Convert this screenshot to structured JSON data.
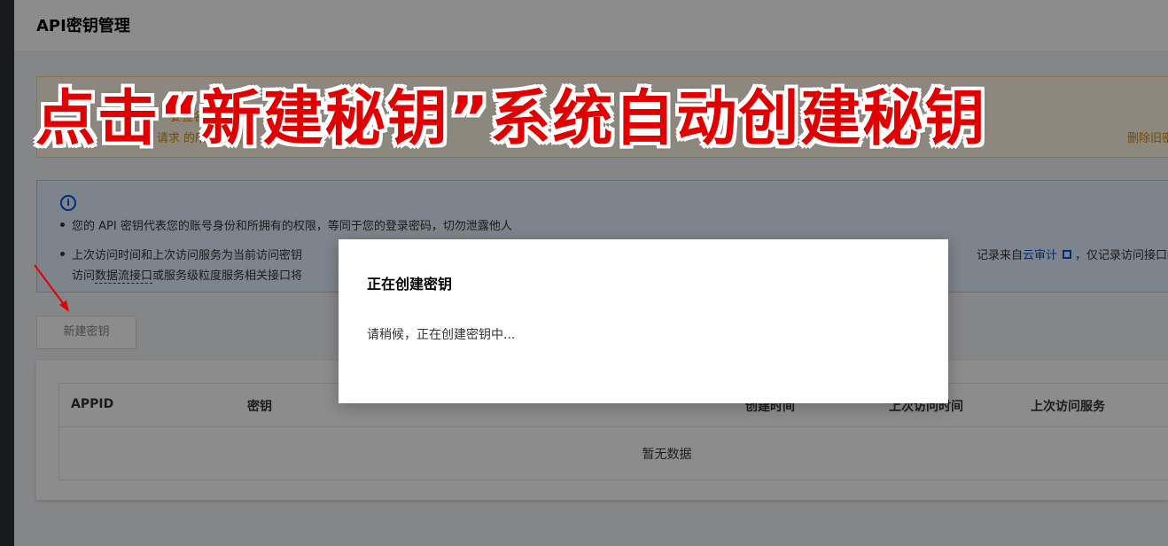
{
  "header": {
    "title": "API密钥管理"
  },
  "warning": {
    "line1": "要签名，云",
    "line2": "讯云 API 请求                                              的所有腾讯",
    "line2_tail": "删除旧密钥"
  },
  "info": {
    "bullet1": "您的 API 密钥代表您的账号身份和所拥有的权限，等同于您的登录密码，切勿泄露他人",
    "bullet2_start": "上次访问时间和上次访问服务为当前访问密钥",
    "bullet2_line2_a": "访问",
    "bullet2_line2_dashed": "数据流接口",
    "bullet2_line2_b": "或服务级粒度服务相关接口将",
    "bullet2_right_a": "记录来自",
    "bullet2_right_link": "云审计",
    "bullet2_right_b": "，仅记录访问接口级"
  },
  "actions": {
    "new_key_label": "新建密钥"
  },
  "table": {
    "columns": [
      "APPID",
      "密钥",
      "创建时间",
      "上次访问时间",
      "上次访问服务"
    ],
    "empty_text": "暂无数据"
  },
  "dialog": {
    "title": "正在创建密钥",
    "body": "请稍候，正在创建密钥中..."
  },
  "annotation": {
    "banner_text": "点击“新建秘钥”系统自动创建秘钥",
    "color": "#e00000"
  }
}
